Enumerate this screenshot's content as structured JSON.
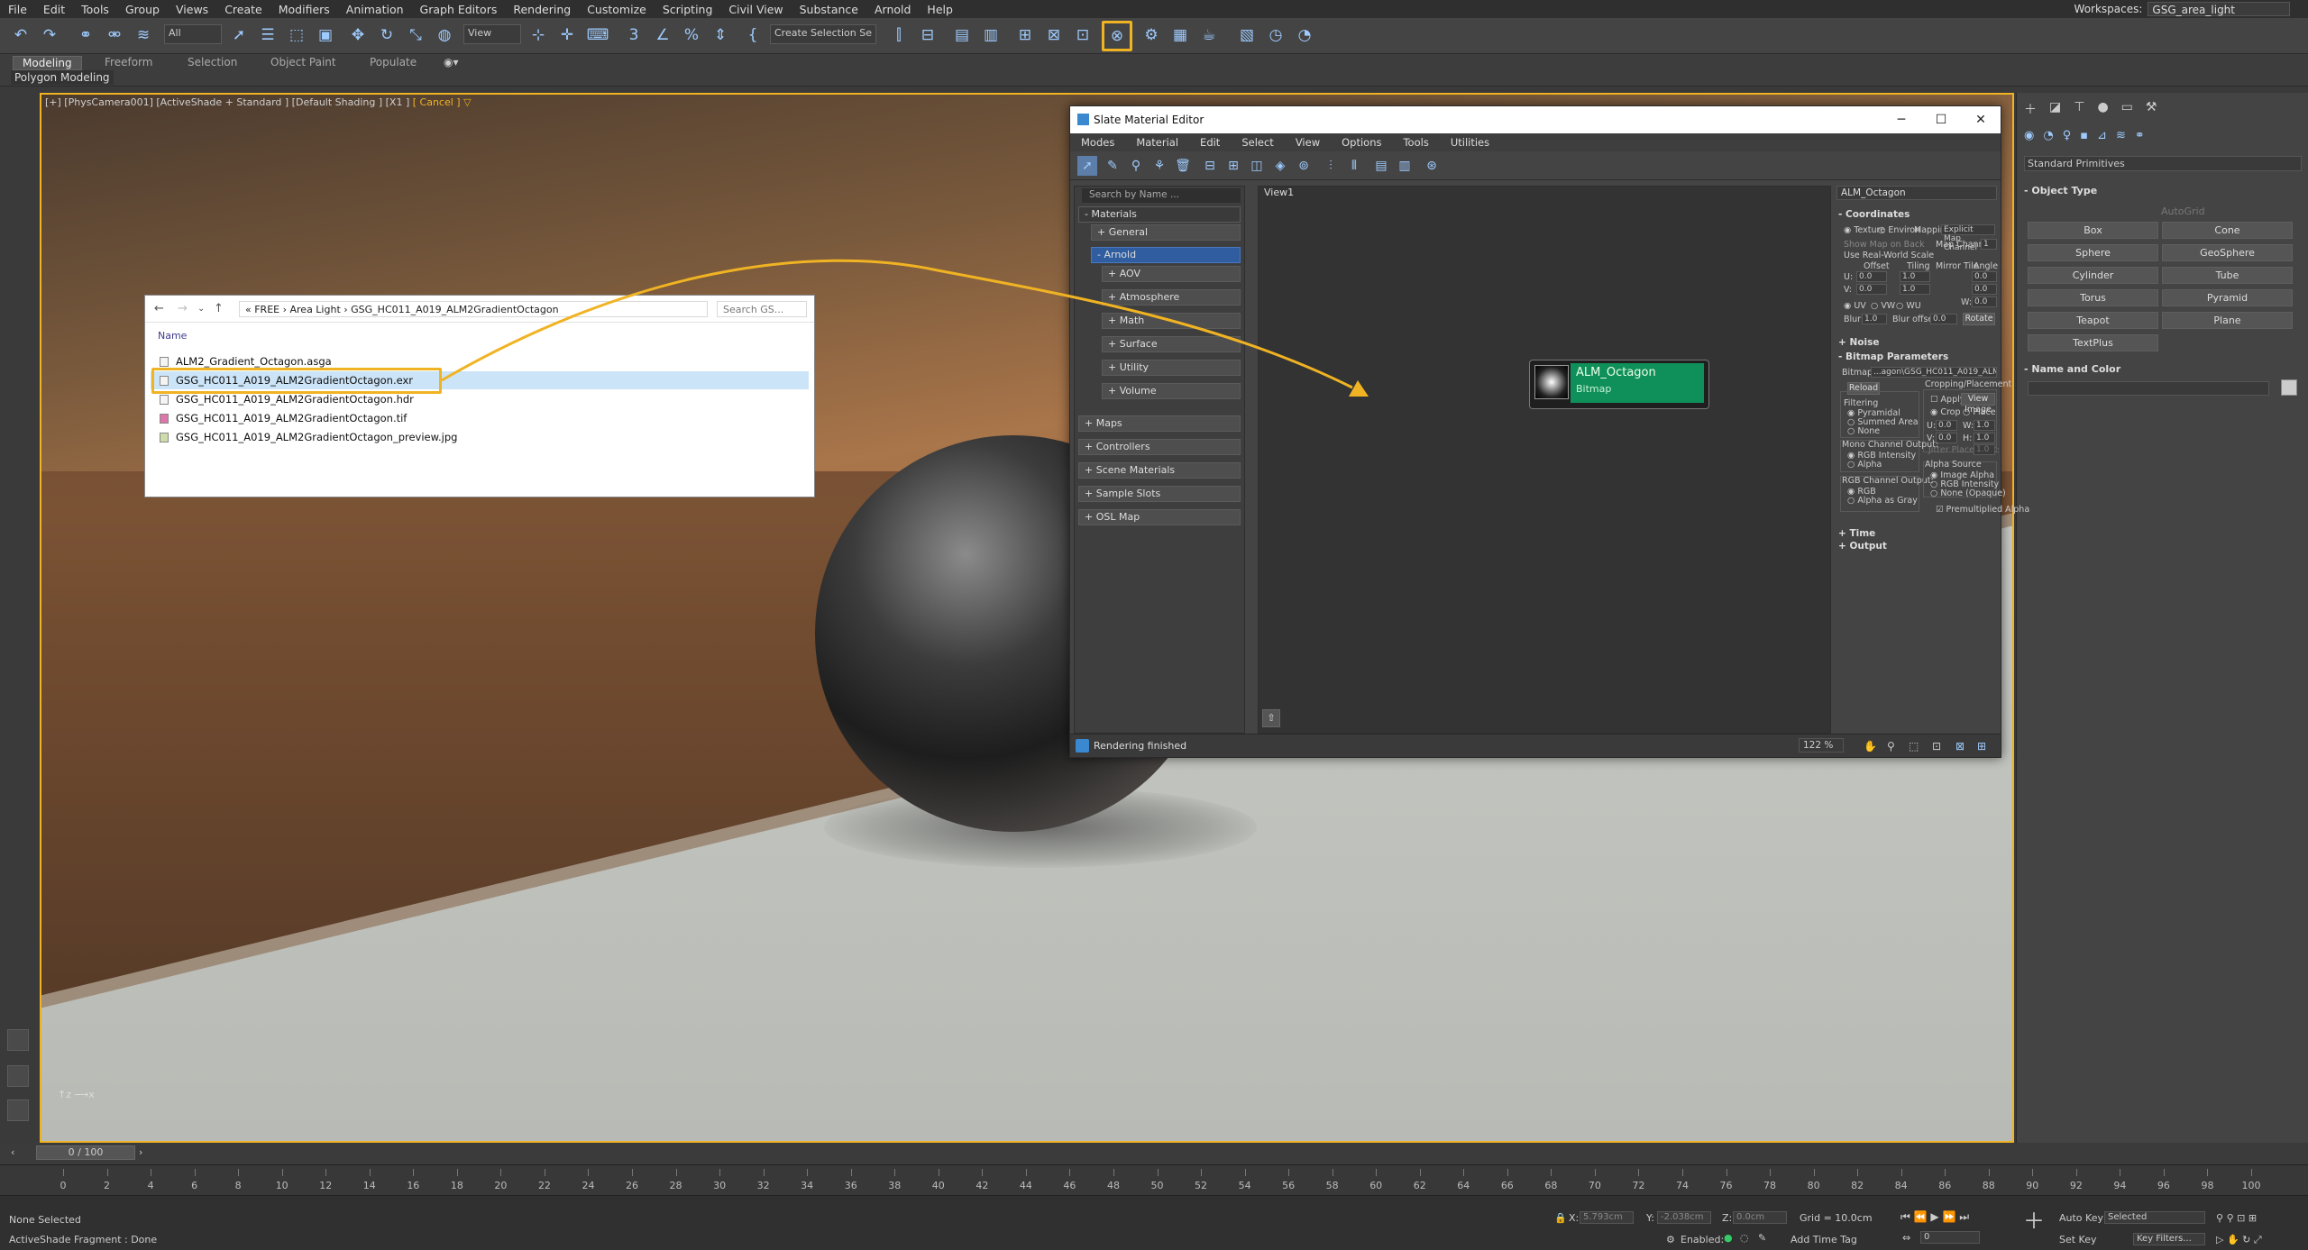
{
  "menubar": {
    "items": [
      "File",
      "Edit",
      "Tools",
      "Group",
      "Views",
      "Create",
      "Modifiers",
      "Animation",
      "Graph Editors",
      "Rendering",
      "Customize",
      "Scripting",
      "Civil View",
      "Substance",
      "Arnold",
      "Help"
    ],
    "workspaces_label": "Workspaces:",
    "workspaces_value": "GSG_area_light"
  },
  "toolbar": {
    "selection_filter": "All",
    "ref_coord": "View",
    "named_selection": "Create Selection Se"
  },
  "ribbon": {
    "tabs": [
      "Modeling",
      "Freeform",
      "Selection",
      "Object Paint",
      "Populate"
    ],
    "active_tab": "Modeling",
    "sub_label": "Polygon Modeling"
  },
  "viewport": {
    "label": "[+] [PhysCamera001] [ActiveShade + Standard ] [Default Shading ] [X1 ]",
    "cancel": "[ Cancel ]",
    "cancel_suffix": "▽"
  },
  "explorer": {
    "breadcrumb": "«  FREE  ›  Area Light  ›  GSG_HC011_A019_ALM2GradientOctagon",
    "search_placeholder": "Search GS...",
    "column_header": "Name",
    "files": [
      "ALM2_Gradient_Octagon.asga",
      "GSG_HC011_A019_ALM2GradientOctagon.exr",
      "GSG_HC011_A019_ALM2GradientOctagon.hdr",
      "GSG_HC011_A019_ALM2GradientOctagon.tif",
      "GSG_HC011_A019_ALM2GradientOctagon_preview.jpg"
    ],
    "selected_index": 1
  },
  "slate": {
    "title": "Slate Material Editor",
    "menu": [
      "Modes",
      "Material",
      "Edit",
      "Select",
      "View",
      "Options",
      "Tools",
      "Utilities"
    ],
    "search_placeholder": "Search by Name ...",
    "browser": {
      "materials": "- Materials",
      "general": "+ General",
      "arnold": "- Arnold",
      "aov": "+ AOV",
      "atmosphere": "+ Atmosphere",
      "math": "+ Math",
      "surface": "+ Surface",
      "utility": "+ Utility",
      "volume": "+ Volume",
      "maps": "+ Maps",
      "controllers": "+ Controllers",
      "scene_materials": "+ Scene Materials",
      "sample_slots": "+ Sample Slots",
      "osl_map": "+ OSL Map"
    },
    "view_tab": "View1",
    "node": {
      "title": "ALM_Octagon",
      "type": "Bitmap"
    },
    "params": {
      "name": "ALM_Octagon",
      "coordinates": "Coordinates",
      "texture": "Texture",
      "environ": "Environ",
      "mapping_label": "Mapping:",
      "mapping_value": "Explicit Map Channel",
      "show_map_on_back": "Show Map on Back",
      "map_channel_label": "Map Channel:",
      "map_channel_value": "1",
      "use_real_world": "Use Real-World Scale",
      "offset": "Offset",
      "tiling": "Tiling",
      "mirror_tile": "Mirror Tile",
      "angle": "Angle",
      "u": "U:",
      "v": "V:",
      "w": "W:",
      "zero": "0.0",
      "one": "1.0",
      "uv": "UV",
      "vw": "VW",
      "wu": "WU",
      "blur_label": "Blur:",
      "blur_value": "1.0",
      "blur_offset_label": "Blur offset:",
      "blur_offset_value": "0.0",
      "rotate": "Rotate",
      "noise": "Noise",
      "bitmap_params": "Bitmap Parameters",
      "bitmap_label": "Bitmap:",
      "bitmap_value": "...agon\\GSG_HC011_A019_ALM2GradientOctagon.exr",
      "reload": "Reload",
      "cropping": "Cropping/Placement",
      "apply": "Apply",
      "view_image": "View Image",
      "crop": "Crop",
      "place": "Place",
      "filtering": "Filtering",
      "pyramidal": "Pyramidal",
      "summed_area": "Summed Area",
      "none": "None",
      "mono_output": "Mono Channel Output:",
      "rgb_intensity": "RGB Intensity",
      "alpha": "Alpha",
      "rgb_output": "RGB Channel Output:",
      "rgb": "RGB",
      "alpha_as_gray": "Alpha as Gray",
      "jitter": "Jitter Placement:",
      "jitter_value": "1.0",
      "u_label": "U:",
      "v_label": "V:",
      "w_label2": "W:",
      "h_label": "H:",
      "alpha_source": "Alpha Source",
      "image_alpha": "Image Alpha",
      "rgb_intensity2": "RGB Intensity",
      "none_opaque": "None (Opaque)",
      "premult": "Premultiplied Alpha",
      "time": "Time",
      "output": "Output"
    },
    "status": "Rendering finished",
    "zoom": "122 %"
  },
  "command_panel": {
    "dropdown": "Standard Primitives",
    "object_type": "Object Type",
    "autogrid": "AutoGrid",
    "buttons": [
      "Box",
      "Cone",
      "Sphere",
      "GeoSphere",
      "Cylinder",
      "Tube",
      "Torus",
      "Pyramid",
      "Teapot",
      "Plane",
      "TextPlus"
    ],
    "name_and_color": "Name and Color"
  },
  "timeline": {
    "slider": "0 / 100",
    "ticks": [
      "0",
      "2",
      "4",
      "6",
      "8",
      "10",
      "12",
      "14",
      "16",
      "18",
      "20",
      "22",
      "24",
      "26",
      "28",
      "30",
      "32",
      "34",
      "36",
      "38",
      "40",
      "42",
      "44",
      "46",
      "48",
      "50",
      "52",
      "54",
      "56",
      "58",
      "60",
      "62",
      "64",
      "66",
      "68",
      "70",
      "72",
      "74",
      "76",
      "78",
      "80",
      "82",
      "84",
      "86",
      "88",
      "90",
      "92",
      "94",
      "96",
      "98",
      "100"
    ]
  },
  "status": {
    "selection": "None Selected",
    "prompt": "ActiveShade Fragment : Done",
    "x_label": "X:",
    "x_value": "5.793cm",
    "y_label": "Y:",
    "y_value": "-2.038cm",
    "z_label": "Z:",
    "z_value": "0.0cm",
    "grid": "Grid = 10.0cm",
    "enabled": "Enabled:",
    "add_time_tag": "Add Time Tag",
    "auto_key": "Auto Key",
    "selected": "Selected",
    "set_key": "Set Key",
    "key_filters": "Key Filters...",
    "frame": "0"
  },
  "colors": {
    "highlight": "#f0b323",
    "node_green": "#0f8f5a",
    "selection_blue": "#2f5da0"
  }
}
